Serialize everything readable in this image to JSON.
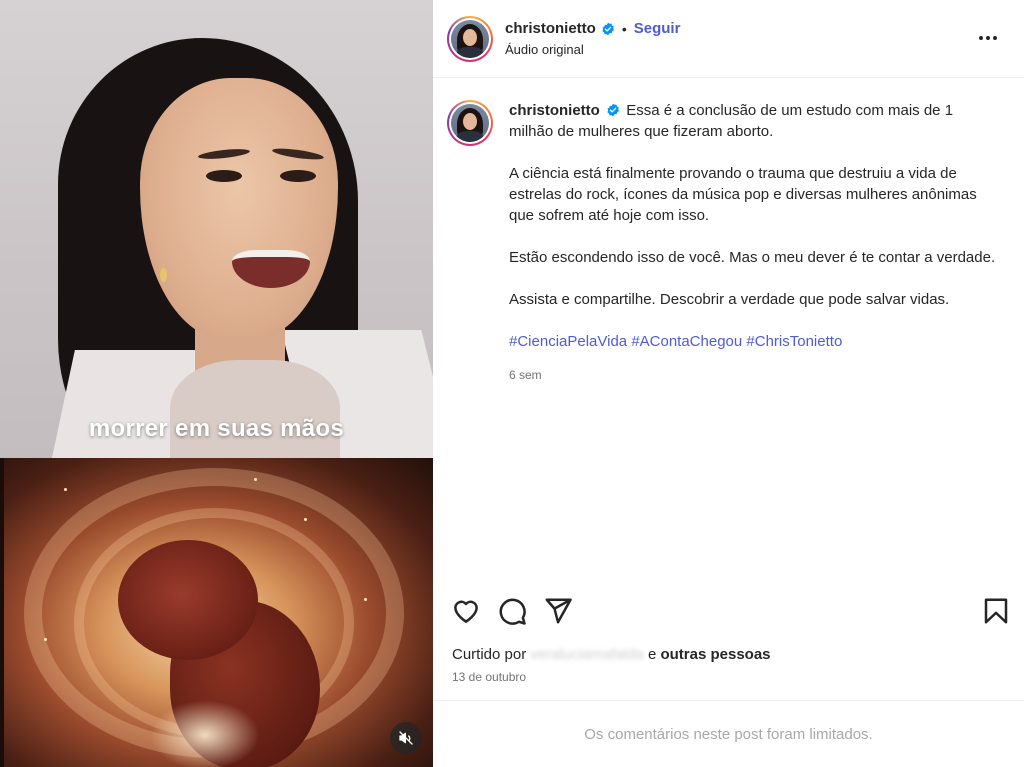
{
  "post": {
    "username": "christonietto",
    "follow_label": "Seguir",
    "separator": "•",
    "audio_label": "Áudio original",
    "more_icon": "more-options-icon"
  },
  "media": {
    "caption_overlay": "morrer em suas mãos",
    "mute_icon": "volume-muted-icon"
  },
  "caption": {
    "username": "christonietto",
    "first_line": "Essa é a conclusão de um estudo com mais de 1 milhão de mulheres que fizeram aborto.",
    "paragraph_2": "A ciência está finalmente provando o trauma que destruiu a vida de estrelas do rock, ícones da música pop e diversas mulheres anônimas que sofrem até hoje com isso.",
    "paragraph_3": "Estão escondendo isso de você. Mas o meu dever é te contar a verdade.",
    "paragraph_4": "Assista e compartilhe. Descobrir a verdade que pode salvar vidas.",
    "hashtags": [
      "#CienciaPelaVida",
      "#AContaChegou",
      "#ChrisTonietto"
    ],
    "time_ago": "6 sem"
  },
  "actions": {
    "like_icon": "heart-icon",
    "comment_icon": "comment-icon",
    "share_icon": "share-icon",
    "save_icon": "bookmark-icon"
  },
  "likes": {
    "prefix": "Curtido por",
    "blurred_user": "veraluciamafalda",
    "connector": "e",
    "others": "outras pessoas"
  },
  "date": "13 de outubro",
  "comments_limited": "Os comentários neste post foram limitados.",
  "colors": {
    "link": "#4f5bd5",
    "verified": "#0095f6",
    "muted_text": "#737373"
  }
}
